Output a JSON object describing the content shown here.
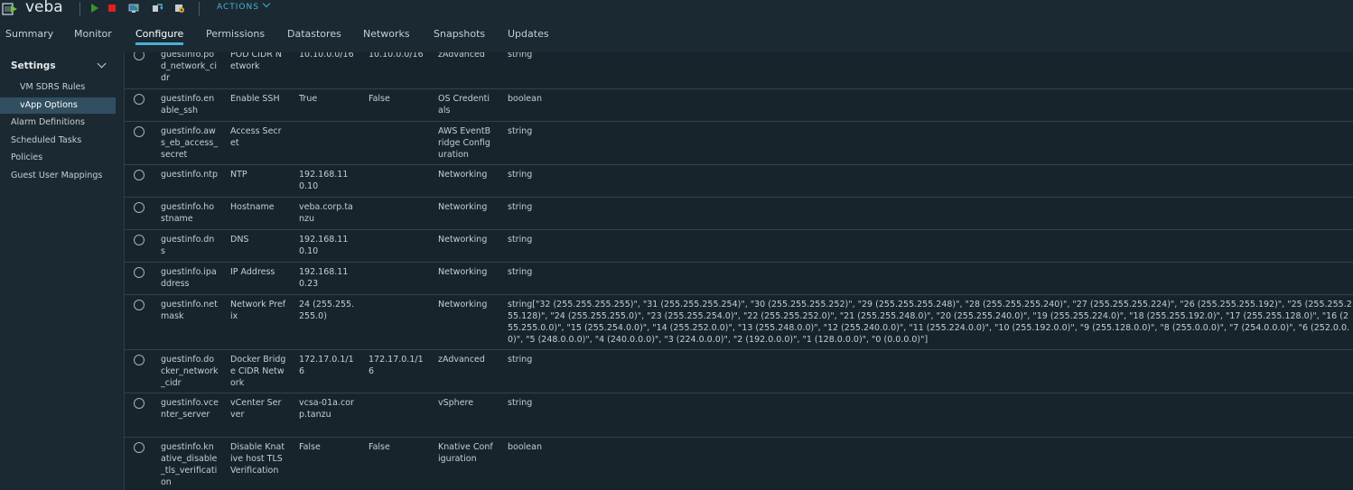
{
  "header": {
    "vm_name": "veba",
    "actions_label": "ACTIONS",
    "toolbar_icons": [
      "power-on-icon",
      "power-off-icon",
      "launch-console-icon",
      "migrate-icon",
      "edit-settings-icon"
    ],
    "colors": {
      "accent": "#49afd9",
      "power_on": "#3f8f2f",
      "power_off": "#e02020"
    }
  },
  "tabs": [
    {
      "label": "Summary",
      "active": false
    },
    {
      "label": "Monitor",
      "active": false
    },
    {
      "label": "Configure",
      "active": true
    },
    {
      "label": "Permissions",
      "active": false
    },
    {
      "label": "Datastores",
      "active": false
    },
    {
      "label": "Networks",
      "active": false
    },
    {
      "label": "Snapshots",
      "active": false
    },
    {
      "label": "Updates",
      "active": false
    }
  ],
  "sidebar": {
    "heading": "Settings",
    "items": [
      {
        "label": "VM SDRS Rules",
        "level": "sub",
        "selected": false
      },
      {
        "label": "vApp Options",
        "level": "sub",
        "selected": true
      },
      {
        "label": "Alarm Definitions",
        "level": "top",
        "selected": false
      },
      {
        "label": "Scheduled Tasks",
        "level": "top",
        "selected": false
      },
      {
        "label": "Policies",
        "level": "top",
        "selected": false
      },
      {
        "label": "Guest User Mappings",
        "level": "top",
        "selected": false
      }
    ]
  },
  "properties": [
    {
      "key": "guestinfo.pod_network_cidr",
      "label": "POD CIDR Network",
      "value": "10.10.0.0/16",
      "default": "10.10.0.0/16",
      "category": "zAdvanced",
      "type": "string"
    },
    {
      "key": "guestinfo.enable_ssh",
      "label": "Enable SSH",
      "value": "True",
      "default": "False",
      "category": "OS Credentials",
      "type": "boolean"
    },
    {
      "key": "guestinfo.aws_eb_access_secret",
      "label": "Access Secret",
      "value": "",
      "default": "",
      "category": "AWS EventBridge Configuration",
      "type": "string"
    },
    {
      "key": "guestinfo.ntp",
      "label": "NTP",
      "value": "192.168.110.10",
      "default": "",
      "category": "Networking",
      "type": "string"
    },
    {
      "key": "guestinfo.hostname",
      "label": "Hostname",
      "value": "veba.corp.tanzu",
      "default": "",
      "category": "Networking",
      "type": "string"
    },
    {
      "key": "guestinfo.dns",
      "label": "DNS",
      "value": "192.168.110.10",
      "default": "",
      "category": "Networking",
      "type": "string"
    },
    {
      "key": "guestinfo.ipaddress",
      "label": "IP Address",
      "value": "192.168.110.23",
      "default": "",
      "category": "Networking",
      "type": "string"
    },
    {
      "key": "guestinfo.netmask",
      "label": "Network Prefix",
      "value": "24 (255.255.255.0)",
      "default": "",
      "category": "Networking",
      "type": "string[\"32 (255.255.255.255)\", \"31 (255.255.255.254)\", \"30 (255.255.255.252)\", \"29 (255.255.255.248)\", \"28 (255.255.255.240)\", \"27 (255.255.255.224)\", \"26 (255.255.255.192)\", \"25 (255.255.255.128)\", \"24 (255.255.255.0)\", \"23 (255.255.254.0)\", \"22 (255.255.252.0)\", \"21 (255.255.248.0)\", \"20 (255.255.240.0)\", \"19 (255.255.224.0)\", \"18 (255.255.192.0)\", \"17 (255.255.128.0)\", \"16 (255.255.0.0)\", \"15 (255.254.0.0)\", \"14 (255.252.0.0)\", \"13 (255.248.0.0)\", \"12 (255.240.0.0)\", \"11 (255.224.0.0)\", \"10 (255.192.0.0)\", \"9 (255.128.0.0)\", \"8 (255.0.0.0)\", \"7 (254.0.0.0)\", \"6 (252.0.0.0)\", \"5 (248.0.0.0)\", \"4 (240.0.0.0)\", \"3 (224.0.0.0)\", \"2 (192.0.0.0)\", \"1 (128.0.0.0)\", \"0 (0.0.0.0)\"]"
    },
    {
      "key": "guestinfo.docker_network_cidr",
      "label": "Docker Bridge CIDR Network",
      "value": "172.17.0.1/16",
      "default": "172.17.0.1/16",
      "category": "zAdvanced",
      "type": "string"
    },
    {
      "key": "guestinfo.vcenter_server",
      "label": "vCenter Server",
      "value": "vcsa-01a.corp.tanzu",
      "default": "",
      "category": "vSphere",
      "type": "string"
    },
    {
      "key": "guestinfo.knative_disable_tls_verification",
      "label": "Disable Knative host TLS Verification",
      "value": "False",
      "default": "False",
      "category": "Knative Configuration",
      "type": "boolean"
    }
  ]
}
